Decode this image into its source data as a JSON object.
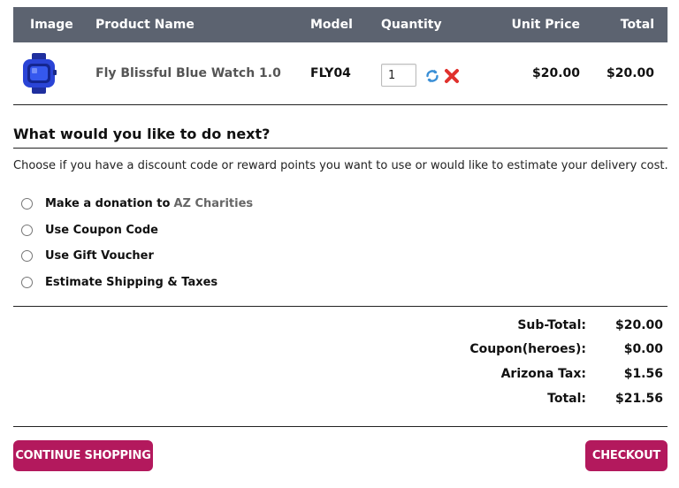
{
  "cart": {
    "headers": {
      "image": "Image",
      "name": "Product Name",
      "model": "Model",
      "quantity": "Quantity",
      "unit_price": "Unit Price",
      "total": "Total"
    },
    "items": [
      {
        "image_icon": "blue-watch-image",
        "name": "Fly Blissful Blue Watch 1.0",
        "model": "FLY04",
        "quantity": "1",
        "unit_price": "$20.00",
        "total": "$20.00"
      }
    ],
    "actions": {
      "update_icon": "refresh-icon",
      "remove_icon": "remove-icon"
    }
  },
  "next": {
    "title": "What would you like to do next?",
    "description": "Choose if you have a discount code or reward points you want to use or would like to estimate your delivery cost.",
    "options": [
      {
        "label": "Make a donation to",
        "link": "AZ Charities"
      },
      {
        "label": "Use Coupon Code"
      },
      {
        "label": "Use Gift Voucher"
      },
      {
        "label": "Estimate Shipping & Taxes"
      }
    ]
  },
  "totals": [
    {
      "label": "Sub-Total:",
      "value": "$20.00"
    },
    {
      "label": "Coupon(heroes):",
      "value": "$0.00"
    },
    {
      "label": "Arizona Tax:",
      "value": "$1.56"
    },
    {
      "label": "Total:",
      "value": "$21.56"
    }
  ],
  "buttons": {
    "continue": "CONTINUE SHOPPING",
    "checkout": "CHECKOUT"
  },
  "colors": {
    "header_bg": "#5c6370",
    "button_bg": "#b3195d",
    "link": "#666666"
  }
}
